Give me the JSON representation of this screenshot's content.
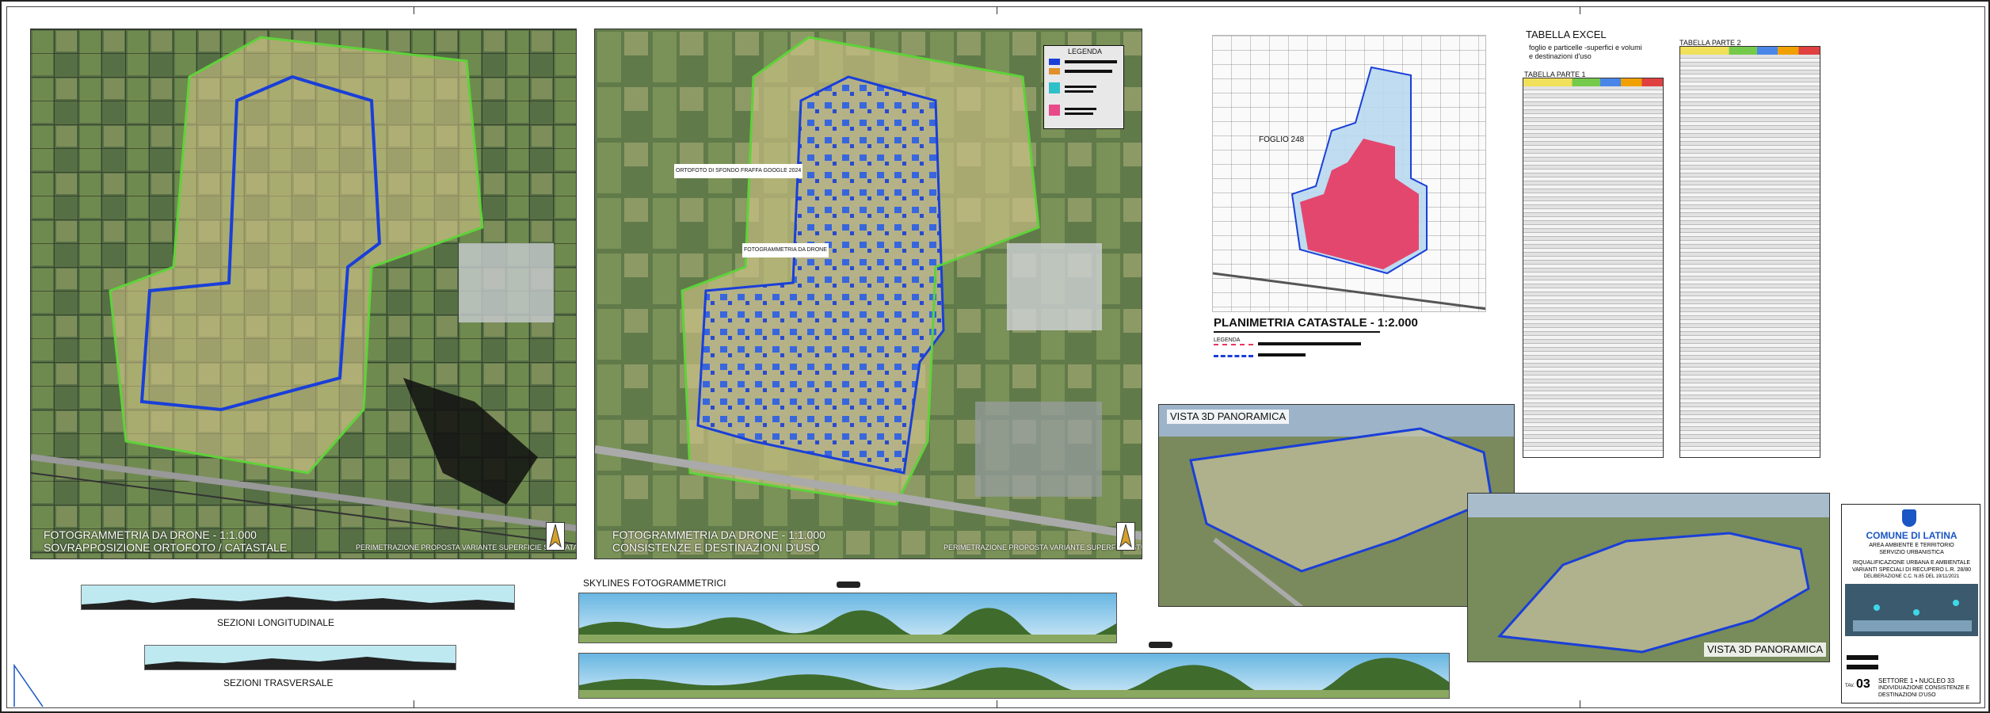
{
  "map1": {
    "title_line1": "FOTOGRAMMETRIA DA DRONE - 1:1.000",
    "title_line2": "SOVRAPPOSIZIONE ORTOFOTO / CATASTALE",
    "legend_text": "PERIMETRAZIONE PROPOSTA VARIANTE SUPERFICIE STUDIATA MQ"
  },
  "map2": {
    "title_line1": "FOTOGRAMMETRIA DA DRONE - 1:1.000",
    "title_line2": "CONSISTENZE E DESTINAZIONI D'USO",
    "label_ortofoto": "ORTOFOTO DI SFONDO FRAFFA GOOGLE 2024",
    "label_drone": "FOTOGRAMMETRIA DA DRONE",
    "legend_title": "LEGENDA",
    "legend_text": "PERIMETRAZIONE PROPOSTA VARIANTE SUPERFICIE STUDIATA MQ"
  },
  "cadastral": {
    "title": "PLANIMETRIA CATASTALE - 1:2.000",
    "foglio": "FOGLIO 248",
    "legend_label": "LEGENDA"
  },
  "excel": {
    "title": "TABELLA EXCEL",
    "subtitle1": "foglio e particelle -superfici e volumi",
    "subtitle2": "e destinazioni d'uso",
    "table1": "TABELLA PARTE 1",
    "table2": "TABELLA PARTE 2"
  },
  "views": {
    "view1": "VISTA 3D PANORAMICA",
    "view2": "VISTA 3D PANORAMICA"
  },
  "sections": {
    "longitudinal": "SEZIONI LONGITUDINALE",
    "transversal": "SEZIONI TRASVERSALE",
    "skylines": "SKYLINES FOTOGRAMMETRICI"
  },
  "titleblock": {
    "comune": "COMUNE DI LATINA",
    "dept1": "AREA AMBIENTE E TERRITORIO",
    "dept2": "SERVIZIO URBANISTICA",
    "project1": "RIQUALIFICAZIONE URBANA E AMBIENTALE",
    "project2": "VARIANTI SPECIALI DI RECUPERO L.R. 28/80",
    "delibera": "DELIBERAZIONE C.C. N.85 DEL 19/11/2021",
    "sheet_prefix": "TAV.",
    "sheet_number": "03",
    "settore": "SETTORE 1 • NUCLEO 33",
    "desc1": "INDIVIDUAZIONE CONSISTENZE E",
    "desc2": "DESTINAZIONI D'USO"
  },
  "colors": {
    "perimeter_blue": "#1a3fd8",
    "perimeter_green": "#5fd23a",
    "cadastral_pink": "#e8365f",
    "cadastral_lightblue": "#b8d8f0",
    "comune_blue": "#1a56c4"
  }
}
